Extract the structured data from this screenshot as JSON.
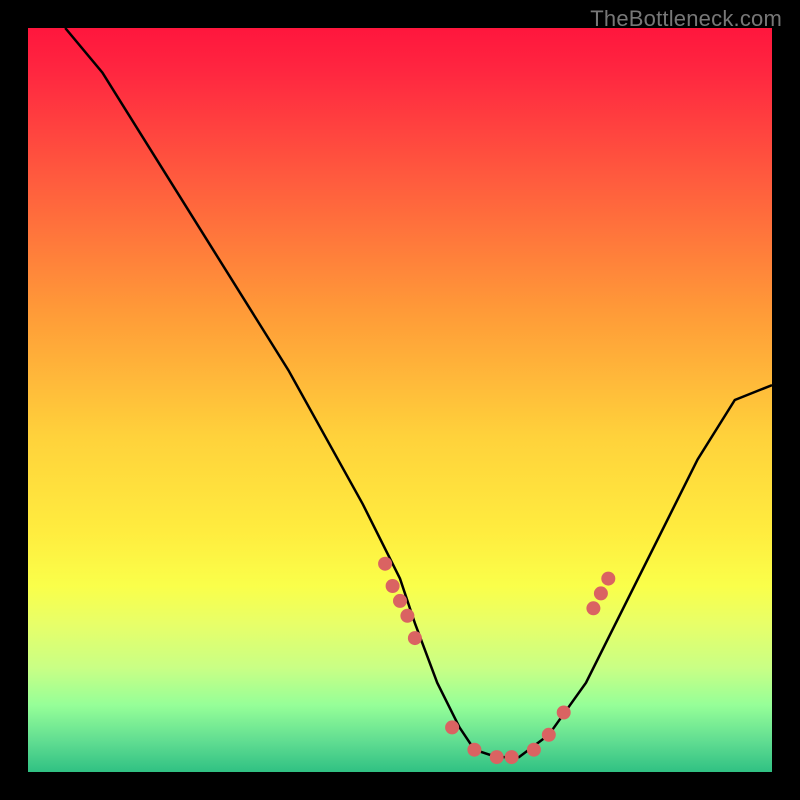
{
  "watermark": "TheBottleneck.com",
  "chart_data": {
    "type": "line",
    "title": "",
    "xlabel": "",
    "ylabel": "",
    "xlim": [
      0,
      100
    ],
    "ylim": [
      0,
      100
    ],
    "curve": {
      "name": "bottleneck-curve",
      "x": [
        5,
        10,
        15,
        20,
        25,
        30,
        35,
        40,
        45,
        50,
        52,
        55,
        58,
        60,
        63,
        66,
        70,
        75,
        80,
        85,
        90,
        95,
        100
      ],
      "y": [
        100,
        94,
        86,
        78,
        70,
        62,
        54,
        45,
        36,
        26,
        20,
        12,
        6,
        3,
        2,
        2,
        5,
        12,
        22,
        32,
        42,
        50,
        52
      ]
    },
    "scatter": {
      "name": "data-points",
      "color": "#da6362",
      "x": [
        48,
        49,
        50,
        51,
        52,
        57,
        60,
        63,
        65,
        68,
        70,
        72,
        76,
        77,
        78
      ],
      "y": [
        28,
        25,
        23,
        21,
        18,
        6,
        3,
        2,
        2,
        3,
        5,
        8,
        22,
        24,
        26
      ]
    }
  }
}
